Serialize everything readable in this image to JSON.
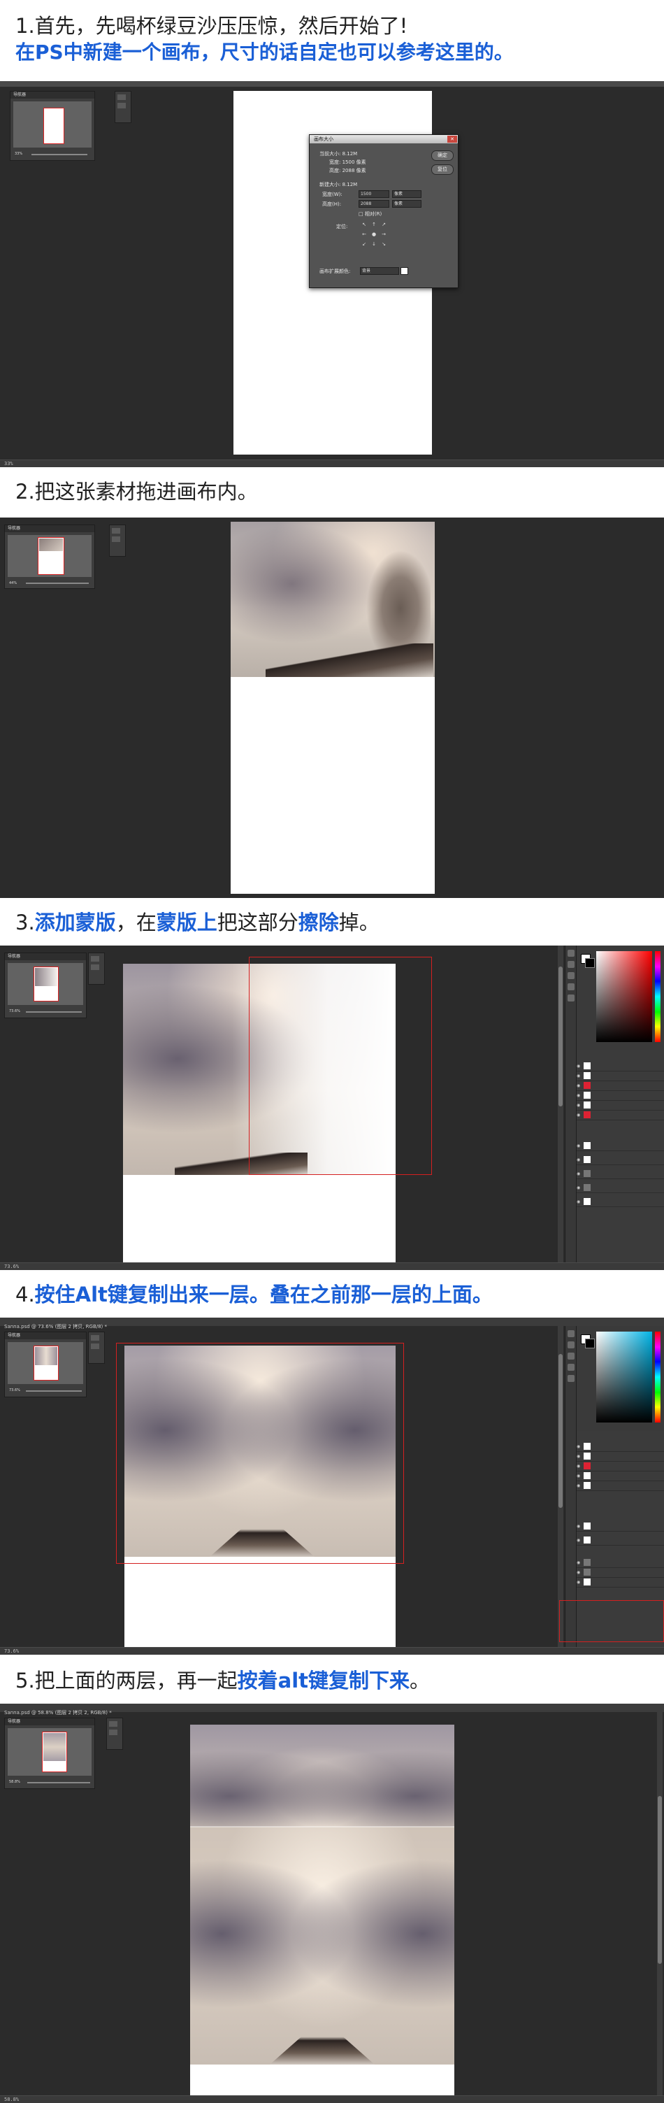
{
  "steps": [
    {
      "title": "1.首先，先喝杯绿豆沙压压惊，然后开始了!",
      "subtitle": "在PS中新建一个画布，尺寸的话自定也可以参考这里的。",
      "navigator_label": "导航器",
      "zoom": "33%",
      "dialog": {
        "title": "画布大小",
        "current_size_label": "当前大小: 8.12M",
        "cur_width": "宽度: 1500 像素",
        "cur_height": "高度: 2088 像素",
        "new_size_label": "新建大小: 8.12M",
        "width_label": "宽度(W):",
        "width_value": "1500",
        "height_label": "高度(H):",
        "height_value": "2088",
        "unit": "像素",
        "relative": "相对(R)",
        "anchor_label": "定位:",
        "ext_color_label": "画布扩展颜色:",
        "ext_color_value": "背景",
        "ok": "确定",
        "cancel": "复位"
      }
    },
    {
      "title": "2.把这张素材拖进画布内。",
      "navigator_label": "导航器",
      "zoom": "44%"
    },
    {
      "title_parts": [
        "3.",
        "添加蒙版",
        "，在",
        "蒙版上",
        "把这部分",
        "擦除",
        "掉。"
      ],
      "navigator_label": "导航器",
      "zoom": "73.6%"
    },
    {
      "title_parts": [
        "4.",
        "按住Alt键复制出来一层。叠在之前那一层的上面。"
      ],
      "tab_label": "Sanna.psd @ 73.6% (图层 2 拷贝, RGB/8) *",
      "navigator_label": "导航器",
      "zoom": "73.6%"
    },
    {
      "title_parts": [
        "5.把上面的两层，再一起",
        "按着alt键复制下来",
        "。"
      ],
      "tab_label": "Sanna.psd @ 58.8% (图层 2 拷贝 2, RGB/8) *",
      "navigator_label": "导航器",
      "zoom": "58.8%"
    }
  ],
  "status": {
    "s1": "33%",
    "s3": "73.6%",
    "s4": "73.6%",
    "s5": "58.8%"
  },
  "colors": {
    "accent_blue": "#1a5fd6",
    "ps_bg": "#2b2b2b",
    "guide_red": "#d42020"
  }
}
